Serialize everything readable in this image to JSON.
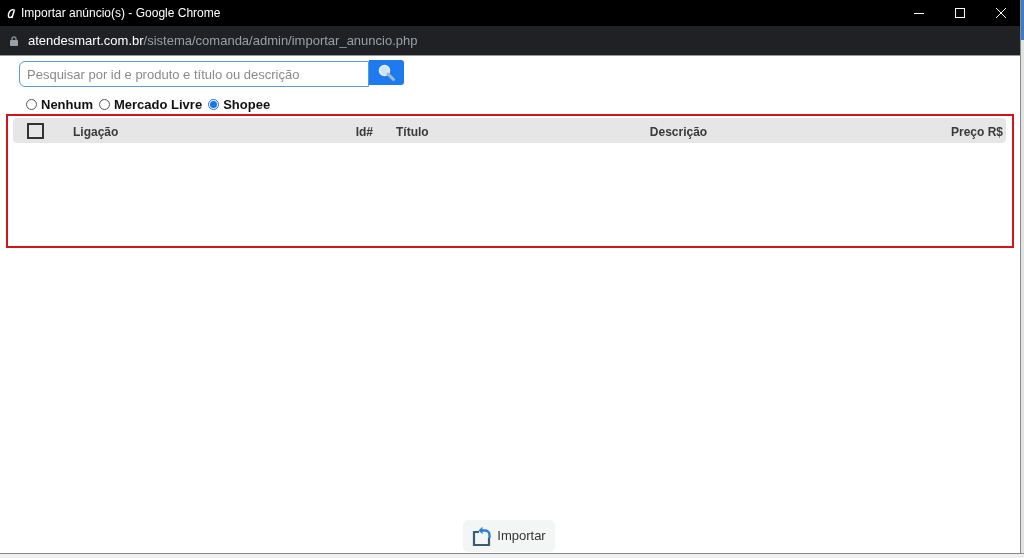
{
  "window": {
    "title": "Importar anúncio(s) - Google Chrome"
  },
  "address_bar": {
    "domain": "atendesmart.com.br",
    "path": "/sistema/comanda/admin/importar_anuncio.php"
  },
  "search": {
    "placeholder": "Pesquisar por id e produto e título ou descrição"
  },
  "source_options": [
    {
      "label": "Nenhum",
      "selected": false
    },
    {
      "label": "Mercado Livre",
      "selected": false
    },
    {
      "label": "Shopee",
      "selected": true
    }
  ],
  "table": {
    "select_all": {
      "checked": false
    },
    "columns": [
      {
        "label": "Ligação"
      },
      {
        "label": "Id#"
      },
      {
        "label": "Título"
      },
      {
        "label": "Descrição"
      },
      {
        "label": "Preço R$"
      }
    ]
  },
  "import_button": {
    "label": "Importar"
  }
}
